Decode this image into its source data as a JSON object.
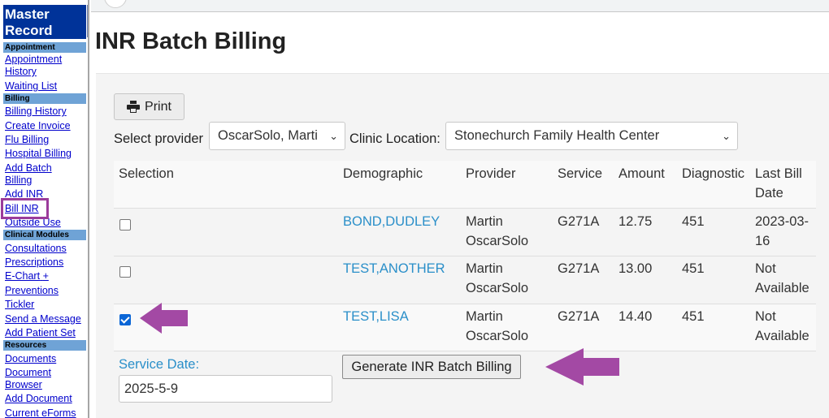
{
  "sidebar": {
    "title_line1": "Master",
    "title_line2": "Record",
    "sections": {
      "appointment": "Appointment",
      "billing": "Billing",
      "clinical": "Clinical Modules",
      "resources": "Resources"
    },
    "links": {
      "appointment_history_1": "Appointment",
      "appointment_history_2": "History",
      "waiting_list": "Waiting List",
      "billing_history": "Billing History",
      "create_invoice": "Create Invoice",
      "flu_billing": "Flu Billing",
      "hospital_billing": "Hospital Billing",
      "add_batch_billing_1": "Add Batch",
      "add_batch_billing_2": "Billing",
      "add_inr": "Add INR",
      "bill_inr": "Bill INR",
      "outside_use": "Outside Use",
      "consultations": "Consultations",
      "prescriptions": "Prescriptions",
      "echart": "E-Chart",
      "echart_plus": "+",
      "preventions": "Preventions",
      "tickler": "Tickler",
      "send_message": "Send a Message",
      "add_patient_set": "Add Patient Set",
      "documents": "Documents",
      "document_browser_1": "Document",
      "document_browser_2": "Browser",
      "add_document": "Add Document",
      "current_eforms": "Current eForms"
    }
  },
  "main": {
    "title": "INR Batch Billing",
    "print_label": "Print",
    "select_provider_label": "Select provider",
    "provider_value": "OscarSolo, Marti",
    "clinic_location_label": "Clinic Location:",
    "clinic_location_value": "Stonechurch Family Health Center",
    "table": {
      "headers": {
        "selection": "Selection",
        "demographic": "Demographic",
        "provider": "Provider",
        "service": "Service",
        "amount": "Amount",
        "diagnostic": "Diagnostic",
        "last_bill_1": "Last Bill",
        "last_bill_2": "Date"
      },
      "rows": [
        {
          "checked": false,
          "demographic": "BOND,DUDLEY",
          "provider_1": "Martin",
          "provider_2": "OscarSolo",
          "service": "G271A",
          "amount": "12.75",
          "diagnostic": "451",
          "last_bill_1": "2023-03-",
          "last_bill_2": "16"
        },
        {
          "checked": false,
          "demographic": "TEST,ANOTHER",
          "provider_1": "Martin",
          "provider_2": "OscarSolo",
          "service": "G271A",
          "amount": "13.00",
          "diagnostic": "451",
          "last_bill_1": "Not",
          "last_bill_2": "Available"
        },
        {
          "checked": true,
          "demographic": "TEST,LISA",
          "provider_1": "Martin",
          "provider_2": "OscarSolo",
          "service": "G271A",
          "amount": "14.40",
          "diagnostic": "451",
          "last_bill_1": "Not",
          "last_bill_2": "Available"
        }
      ]
    },
    "service_date_label": "Service Date:",
    "service_date_value": "2025-5-9",
    "generate_label": "Generate INR Batch Billing"
  },
  "colors": {
    "annotation": "#9b3b9b",
    "link": "#2a8fc9",
    "sidebar_title_bg": "#003399"
  },
  "icons": {
    "print": "printer-icon",
    "select": "chevron-down-icon",
    "annotation": "arrow-left-icon"
  }
}
